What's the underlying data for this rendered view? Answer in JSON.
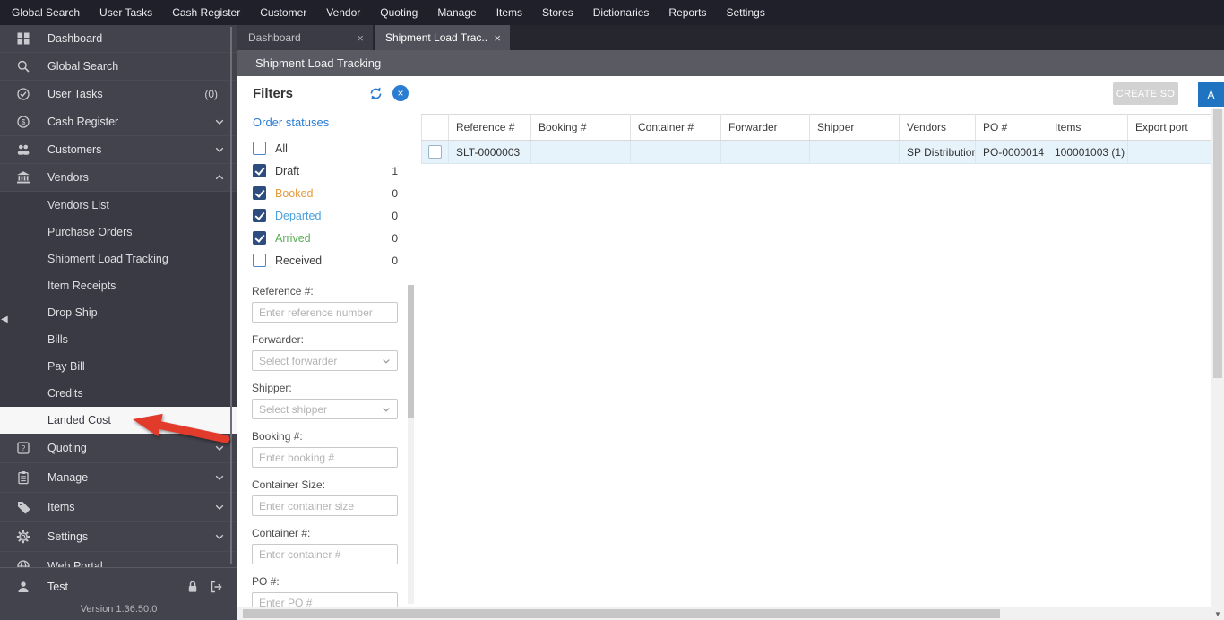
{
  "icons": {
    "close": "×",
    "collapse": "◀",
    "scroll_down": "▼"
  },
  "menubar": {
    "items": [
      "Global Search",
      "User Tasks",
      "Cash Register",
      "Customer",
      "Vendor",
      "Quoting",
      "Manage",
      "Items",
      "Stores",
      "Dictionaries",
      "Reports",
      "Settings"
    ]
  },
  "tabs": [
    {
      "label": "Dashboard",
      "active": false
    },
    {
      "label": "Shipment Load Trac...",
      "active": true
    }
  ],
  "page": {
    "title": "Shipment Load Tracking"
  },
  "sidebar": {
    "items": [
      {
        "label": "Dashboard"
      },
      {
        "label": "Global Search"
      },
      {
        "label": "User Tasks",
        "badge": "(0)"
      },
      {
        "label": "Cash Register"
      },
      {
        "label": "Customers"
      },
      {
        "label": "Vendors",
        "expanded": true
      },
      {
        "label": "Quoting"
      },
      {
        "label": "Manage"
      },
      {
        "label": "Items"
      },
      {
        "label": "Settings"
      },
      {
        "label": "Web Portal"
      }
    ],
    "vendors_children": [
      {
        "label": "Vendors List"
      },
      {
        "label": "Purchase Orders"
      },
      {
        "label": "Shipment Load Tracking"
      },
      {
        "label": "Item Receipts"
      },
      {
        "label": "Drop Ship"
      },
      {
        "label": "Bills"
      },
      {
        "label": "Pay Bill"
      },
      {
        "label": "Credits"
      },
      {
        "label": "Landed Cost",
        "selected": true
      }
    ],
    "user": {
      "name": "Test"
    },
    "version": "Version 1.36.50.0"
  },
  "filters": {
    "title": "Filters",
    "order_statuses_label": "Order statuses",
    "statuses": [
      {
        "label": "All",
        "checked": false,
        "count": ""
      },
      {
        "label": "Draft",
        "checked": true,
        "count": "1"
      },
      {
        "label": "Booked",
        "checked": true,
        "count": "0"
      },
      {
        "label": "Departed",
        "checked": true,
        "count": "0"
      },
      {
        "label": "Arrived",
        "checked": true,
        "count": "0"
      },
      {
        "label": "Received",
        "checked": false,
        "count": "0"
      }
    ],
    "fields": [
      {
        "label": "Reference #:",
        "placeholder": "Enter reference number",
        "type": "input"
      },
      {
        "label": "Forwarder:",
        "placeholder": "Select forwarder",
        "type": "select"
      },
      {
        "label": "Shipper:",
        "placeholder": "Select shipper",
        "type": "select"
      },
      {
        "label": "Booking #:",
        "placeholder": "Enter booking #",
        "type": "input"
      },
      {
        "label": "Container Size:",
        "placeholder": "Enter container size",
        "type": "input"
      },
      {
        "label": "Container #:",
        "placeholder": "Enter container #",
        "type": "input"
      },
      {
        "label": "PO #:",
        "placeholder": "Enter PO #",
        "type": "input"
      }
    ]
  },
  "toolbar": {
    "create_so": "CREATE SO",
    "add_partial": "A"
  },
  "table": {
    "headers": [
      "Reference #",
      "Booking #",
      "Container #",
      "Forwarder",
      "Shipper",
      "Vendors",
      "PO #",
      "Items",
      "Export port"
    ],
    "rows": [
      {
        "reference": "SLT-0000003",
        "booking": "",
        "container": "",
        "forwarder": "",
        "shipper": "",
        "vendors": "SP Distribution",
        "po": "PO-0000014",
        "items": "100001003 (1)",
        "export_port": ""
      }
    ]
  },
  "colors": {
    "accent": "#2b7cd3",
    "link": "#2e8bd0",
    "status_booked": "#e89a3c",
    "status_departed": "#4ba0dc",
    "status_arrived": "#56ae56",
    "row_highlight": "#e7f3fb",
    "selected_nav_bg": "#f7f7f8",
    "annotation_arrow": "#e23b2c"
  }
}
